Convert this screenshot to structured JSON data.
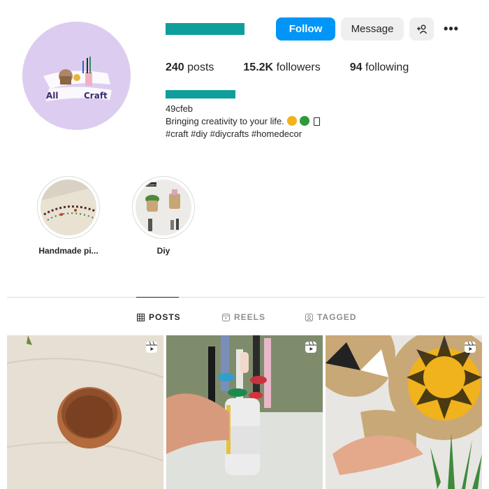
{
  "header": {
    "follow_label": "Follow",
    "message_label": "Message",
    "more_glyph": "•••",
    "avatar_text_left": "All",
    "avatar_text_right": "Craft"
  },
  "stats": [
    {
      "value": "240",
      "label": "posts"
    },
    {
      "value": "15.2K",
      "label": "followers"
    },
    {
      "value": "94",
      "label": "following"
    }
  ],
  "bio": {
    "handle": "49cfeb",
    "line": "Bringing creativity to your life.",
    "tags": "#craft #diy #diycrafts #homedecor"
  },
  "highlights": [
    {
      "label": "Handmade pi..."
    },
    {
      "label": "Diy",
      "thumb_text": "organizers"
    }
  ],
  "tabs": [
    {
      "label": "POSTS",
      "icon": "grid-icon",
      "active": true
    },
    {
      "label": "REELS",
      "icon": "reels-icon",
      "active": false
    },
    {
      "label": "TAGGED",
      "icon": "tagged-icon",
      "active": false
    }
  ],
  "posts": [
    {
      "type": "reel",
      "subject": "terracotta-pot"
    },
    {
      "type": "reel",
      "subject": "toothbrush-holder"
    },
    {
      "type": "reel",
      "subject": "woven-sun-placemat"
    }
  ],
  "colors": {
    "accent": "#0095f6",
    "redacted": "#0f9e9b",
    "avatar_bg": "#dccdf0"
  }
}
